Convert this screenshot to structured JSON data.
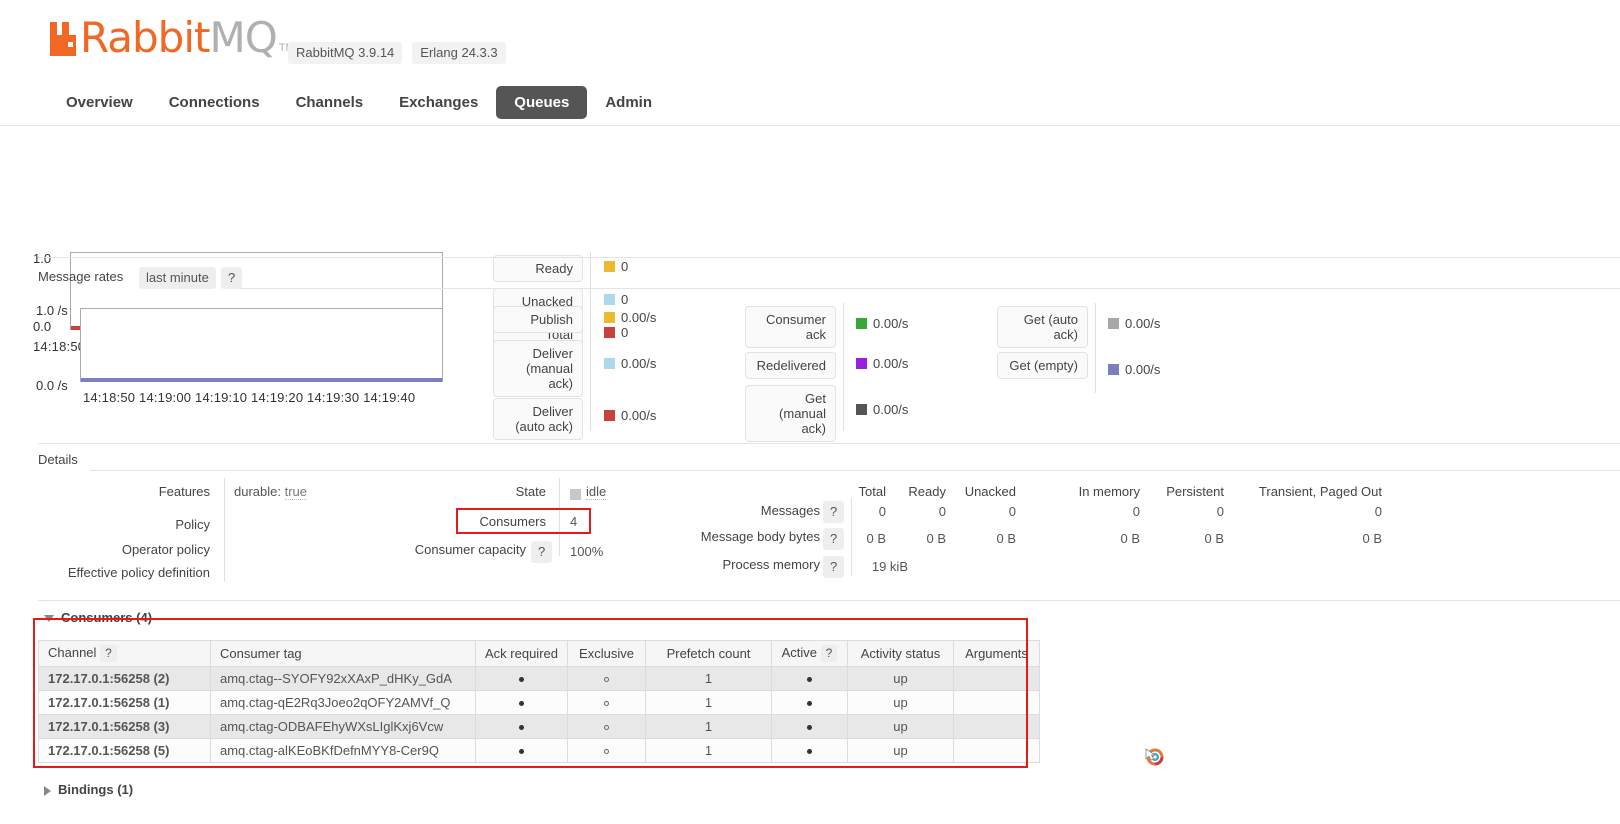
{
  "brand": {
    "name_primary": "Rabbit",
    "name_secondary": "MQ",
    "tm": "TM",
    "accent_color": "#f26724",
    "grey_color": "#b0b0b0"
  },
  "header": {
    "version_pills": [
      "RabbitMQ 3.9.14",
      "Erlang 24.3.3"
    ]
  },
  "nav": {
    "items": [
      {
        "label": "Overview",
        "active": false
      },
      {
        "label": "Connections",
        "active": false
      },
      {
        "label": "Channels",
        "active": false
      },
      {
        "label": "Exchanges",
        "active": false
      },
      {
        "label": "Queues",
        "active": true
      },
      {
        "label": "Admin",
        "active": false
      }
    ]
  },
  "queued_messages_chart": {
    "y_top": "1.0",
    "y_bottom": "0.0",
    "x_ticks": "14:18:50 14:19:00 14:19:10 14:19:20 14:19:30 14:19:40",
    "series": [
      {
        "label": "Ready",
        "value": "0",
        "color": "#edb92e"
      },
      {
        "label": "Unacked",
        "value": "0",
        "color": "#add8ee"
      },
      {
        "label": "Total",
        "value": "0",
        "color": "#c9413c"
      }
    ]
  },
  "message_rates": {
    "title": "Message rates",
    "period": "last minute",
    "help": "?",
    "y_top": "1.0 /s",
    "y_bottom": "0.0 /s",
    "x_ticks": "14:18:50 14:19:00 14:19:10 14:19:20 14:19:30 14:19:40",
    "baseline_color": "#7b7fbe",
    "col1": [
      {
        "label": "Publish",
        "value": "0.00/s",
        "color": "#edb92e"
      },
      {
        "label": "Deliver (manual ack)",
        "value": "0.00/s",
        "color": "#add8ee"
      },
      {
        "label": "Deliver (auto ack)",
        "value": "0.00/s",
        "color": "#c9413c"
      }
    ],
    "col2": [
      {
        "label": "Consumer ack",
        "value": "0.00/s",
        "color": "#36a835"
      },
      {
        "label": "Redelivered",
        "value": "0.00/s",
        "color": "#9b1fe0"
      },
      {
        "label": "Get (manual ack)",
        "value": "0.00/s",
        "color": "#555555"
      }
    ],
    "col3": [
      {
        "label": "Get (auto ack)",
        "value": "0.00/s",
        "color": "#a8a8a8"
      },
      {
        "label": "Get (empty)",
        "value": "0.00/s",
        "color": "#7b7fbe"
      }
    ]
  },
  "details": {
    "title": "Details",
    "left_labels": [
      "Features",
      "Policy",
      "Operator policy",
      "Effective policy definition"
    ],
    "features_key": "durable:",
    "features_value": "true",
    "mid": {
      "state_label": "State",
      "state_value": "idle",
      "consumers_label": "Consumers",
      "consumers_value": "4",
      "capacity_label": "Consumer capacity",
      "capacity_help": "?",
      "capacity_value": "100%"
    },
    "stats_columns": [
      "Total",
      "Ready",
      "Unacked",
      "In memory",
      "Persistent",
      "Transient, Paged Out"
    ],
    "stats_rows": [
      {
        "label": "Messages",
        "help": "?",
        "values": [
          "0",
          "0",
          "0",
          "0",
          "0",
          "0"
        ]
      },
      {
        "label": "Message body bytes",
        "help": "?",
        "values": [
          "0 B",
          "0 B",
          "0 B",
          "0 B",
          "0 B",
          "0 B"
        ]
      },
      {
        "label": "Process memory",
        "help": "?",
        "values": [
          "19 kiB",
          "",
          "",
          "",
          "",
          ""
        ]
      }
    ]
  },
  "consumers_section": {
    "title": "Consumers (4)",
    "columns": [
      "Channel",
      "Consumer tag",
      "Ack required",
      "Exclusive",
      "Prefetch count",
      "Active",
      "Activity status",
      "Arguments"
    ],
    "channel_help": "?",
    "active_help": "?",
    "rows": [
      {
        "channel": "172.17.0.1:56258 (2)",
        "tag": "amq.ctag--SYOFY92xXAxP_dHKy_GdA",
        "ack_required": true,
        "exclusive": false,
        "prefetch": "1",
        "active": true,
        "status": "up",
        "arguments": ""
      },
      {
        "channel": "172.17.0.1:56258 (1)",
        "tag": "amq.ctag-qE2Rq3Joeo2qOFY2AMVf_Q",
        "ack_required": true,
        "exclusive": false,
        "prefetch": "1",
        "active": true,
        "status": "up",
        "arguments": ""
      },
      {
        "channel": "172.17.0.1:56258 (3)",
        "tag": "amq.ctag-ODBAFEhyWXsLIglKxj6Vcw",
        "ack_required": true,
        "exclusive": false,
        "prefetch": "1",
        "active": true,
        "status": "up",
        "arguments": ""
      },
      {
        "channel": "172.17.0.1:56258 (5)",
        "tag": "amq.ctag-alKEoBKfDefnMYY8-Cer9Q",
        "ack_required": true,
        "exclusive": false,
        "prefetch": "1",
        "active": true,
        "status": "up",
        "arguments": ""
      }
    ]
  },
  "bindings_section": {
    "title": "Bindings (1)"
  },
  "annotations": {
    "color": "#e41b17",
    "boxes": [
      "consumers-detail-field",
      "consumers-table"
    ]
  }
}
